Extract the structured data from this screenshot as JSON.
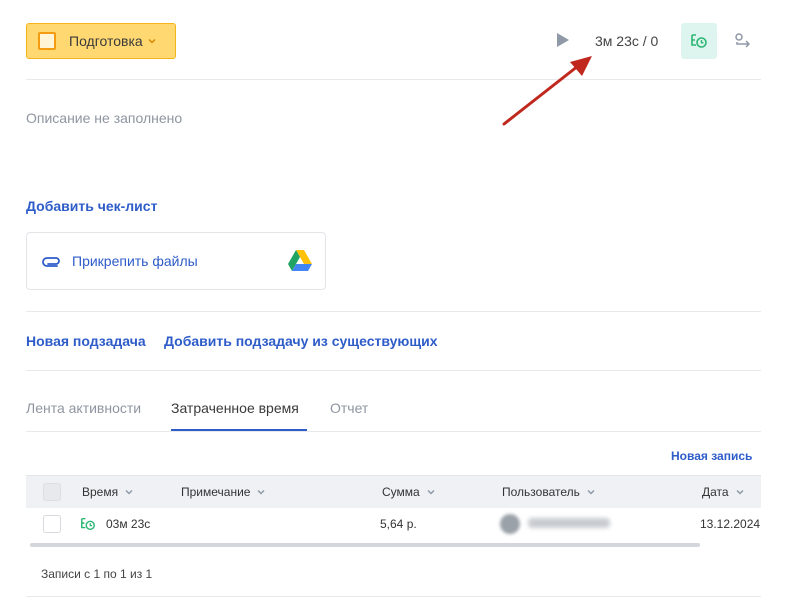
{
  "header": {
    "status_label": "Подготовка",
    "timer_text": "3м 23с / 0"
  },
  "description_placeholder": "Описание не заполнено",
  "checklist": {
    "add_label": "Добавить чек-лист"
  },
  "attachments": {
    "attach_label": "Прикрепить файлы"
  },
  "subtasks": {
    "new_label": "Новая подзадача",
    "add_existing_label": "Добавить подзадачу из существующих"
  },
  "tabs": [
    {
      "label": "Лента активности"
    },
    {
      "label": "Затраченное время"
    },
    {
      "label": "Отчет"
    }
  ],
  "time_table": {
    "new_entry_label": "Новая запись",
    "columns": [
      "Время",
      "Примечание",
      "Сумма",
      "Пользователь",
      "Дата"
    ],
    "rows": [
      {
        "time": "03м 23с",
        "note": "",
        "sum": "5,64 р.",
        "date": "13.12.2024"
      }
    ],
    "footer": "Записи с 1 по 1 из 1"
  },
  "colors": {
    "status_bg": "#ffd872",
    "accent_link": "#2e5cc9",
    "timer_green": "#2bb673",
    "annotation_arrow": "#c0281e"
  },
  "icons": [
    "play-icon",
    "clock-icon",
    "share-icon",
    "paperclip-icon",
    "google-drive-icon",
    "chevron-down-icon"
  ]
}
